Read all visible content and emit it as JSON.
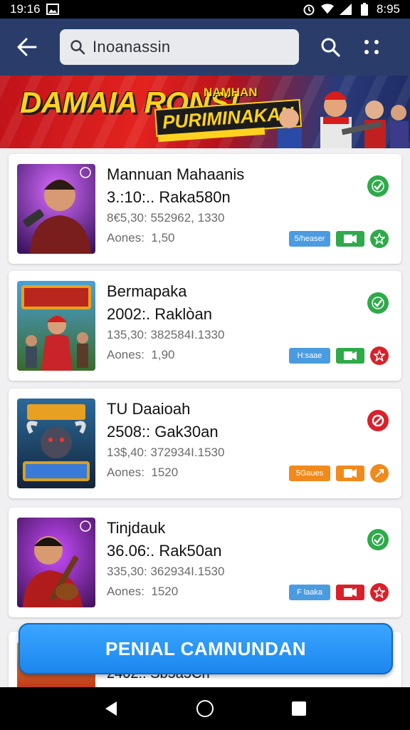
{
  "status_bar": {
    "time_left": "19:16",
    "time_right": "8:95"
  },
  "search": {
    "query": "Inoanassin"
  },
  "banner": {
    "title": "DAMAIA RONS!",
    "tag_small": "NAMHAN",
    "tag_large": "PURIMINAKAN"
  },
  "items": [
    {
      "title": "Mannuan Mahaanis",
      "subtitle": "3.:10:.. Raka580n",
      "meta": "8€5,30: 552962, 1330",
      "agg_label": "Aones:",
      "agg_value": "1,50",
      "status": "ok",
      "badge_text": "5/heaser",
      "badge_color": "#4a9be0",
      "sq_color": "#2eaa4a",
      "circ_color": "#2eaa4a"
    },
    {
      "title": "Bermapaka",
      "subtitle": "2002:. Raklòan",
      "meta": "135,30: 382584I.1330",
      "agg_label": "Aones:",
      "agg_value": "1,90",
      "status": "ok",
      "badge_text": "H:saae",
      "badge_color": "#4a9be0",
      "sq_color": "#2eaa4a",
      "circ_color": "#d9212b"
    },
    {
      "title": "TU Daaioah",
      "subtitle": "2508:: Gak30an",
      "meta": "13$,40: 372934I.1530",
      "agg_label": "Aones:",
      "agg_value": "1520",
      "status": "bad",
      "badge_text": "5Gaues",
      "badge_color": "#f08a1c",
      "sq_color": "#f08a1c",
      "circ_color": "#f08a1c"
    },
    {
      "title": "Tinjdauk",
      "subtitle": "36.06:. Rak50an",
      "meta": "335,30: 362934I.1530",
      "agg_label": "Aones:",
      "agg_value": "1520",
      "status": "ok",
      "badge_text": "F laaka",
      "badge_color": "#4a9be0",
      "sq_color": "#d9212b",
      "circ_color": "#d9212b"
    }
  ],
  "peek_item": {
    "subtitle": "2402:. Sb5a5Cn"
  },
  "cta": {
    "label": "PENIAL CAMNUNDAN"
  },
  "colors": {
    "app_bar": "#2a3d6a",
    "ok": "#2eaa4a",
    "bad": "#d9212b",
    "cta": "#1c86ee"
  }
}
